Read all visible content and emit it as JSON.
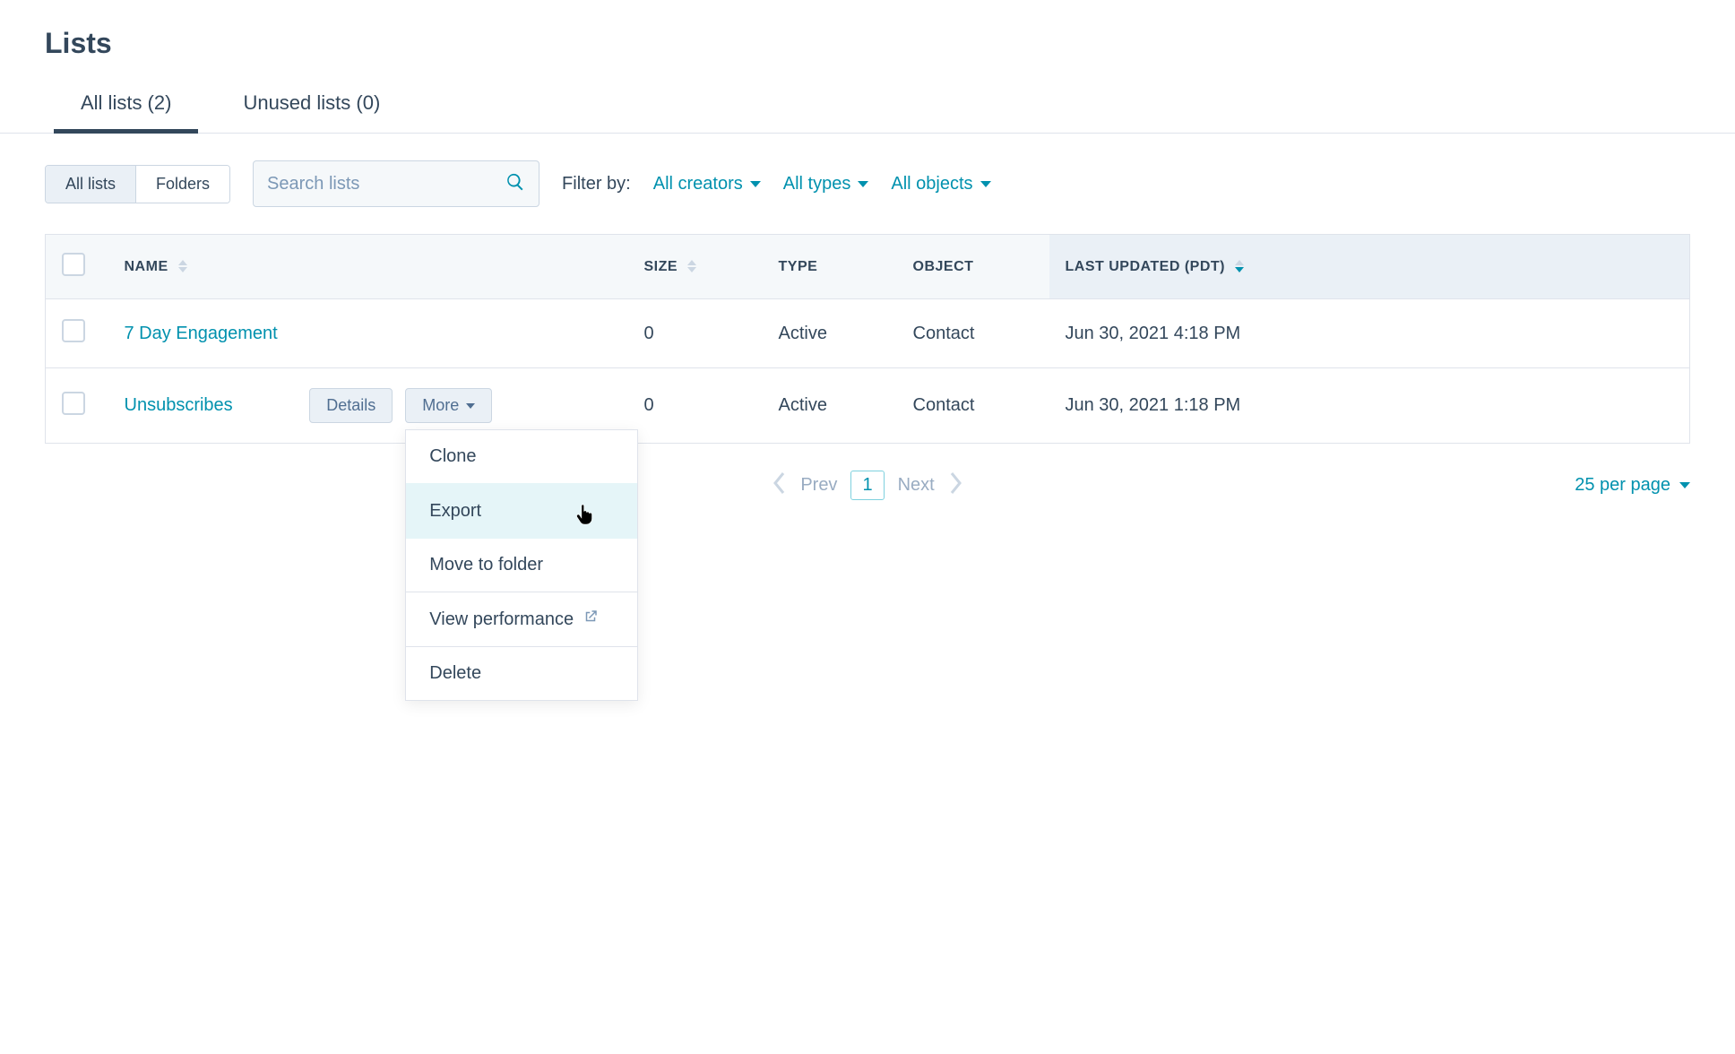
{
  "page_title": "Lists",
  "tabs": [
    {
      "label": "All lists (2)",
      "active": true
    },
    {
      "label": "Unused lists (0)",
      "active": false
    }
  ],
  "segmented": {
    "all_lists": "All lists",
    "folders": "Folders"
  },
  "search_placeholder": "Search lists",
  "filters": {
    "label": "Filter by:",
    "creators": "All creators",
    "types": "All types",
    "objects": "All objects"
  },
  "columns": {
    "name": "NAME",
    "size": "SIZE",
    "type": "TYPE",
    "object": "OBJECT",
    "last_updated": "LAST UPDATED (PDT)"
  },
  "rows": [
    {
      "name": "7 Day Engagement",
      "size": "0",
      "type": "Active",
      "object": "Contact",
      "last_updated": "Jun 30, 2021 4:18 PM"
    },
    {
      "name": "Unsubscribes",
      "size": "0",
      "type": "Active",
      "object": "Contact",
      "last_updated": "Jun 30, 2021 1:18 PM"
    }
  ],
  "row_actions": {
    "details": "Details",
    "more": "More"
  },
  "more_menu": {
    "clone": "Clone",
    "export": "Export",
    "move": "Move to folder",
    "view_perf": "View performance",
    "delete": "Delete"
  },
  "pagination": {
    "prev": "Prev",
    "page": "1",
    "next": "Next",
    "per_page": "25 per page"
  }
}
